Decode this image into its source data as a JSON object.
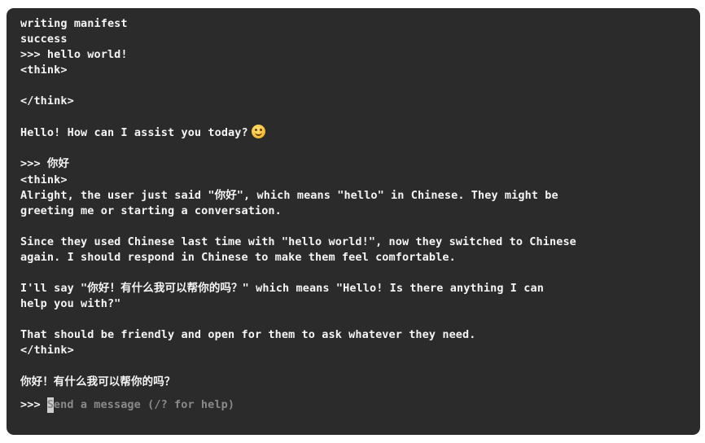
{
  "terminal": {
    "lines": [
      "writing manifest",
      "success",
      ">>> hello world!",
      "<think>",
      "",
      "</think>",
      "",
      "Hello! How can I assist you today?",
      "",
      ">>> 你好",
      "<think>",
      "Alright, the user just said \"你好\", which means \"hello\" in Chinese. They might be",
      "greeting me or starting a conversation.",
      "",
      "Since they used Chinese last time with \"hello world!\", now they switched to Chinese",
      "again. I should respond in Chinese to make them feel comfortable.",
      "",
      "I'll say \"你好！有什么我可以帮你的吗？\" which means \"Hello! Is there anything I can",
      "help you with?\"",
      "",
      "That should be friendly and open for them to ask whatever they need.",
      "</think>",
      "",
      "你好！有什么我可以帮你的吗？"
    ],
    "emoji_icon": "smiling-face-emoji",
    "prompt": {
      "symbol": ">>> ",
      "cursor_char": "S",
      "placeholder_rest": "end a message (/? for help)"
    },
    "colors": {
      "background": "#2b2b2b",
      "text": "#f4f4f4",
      "placeholder": "#8a8a8a"
    }
  }
}
